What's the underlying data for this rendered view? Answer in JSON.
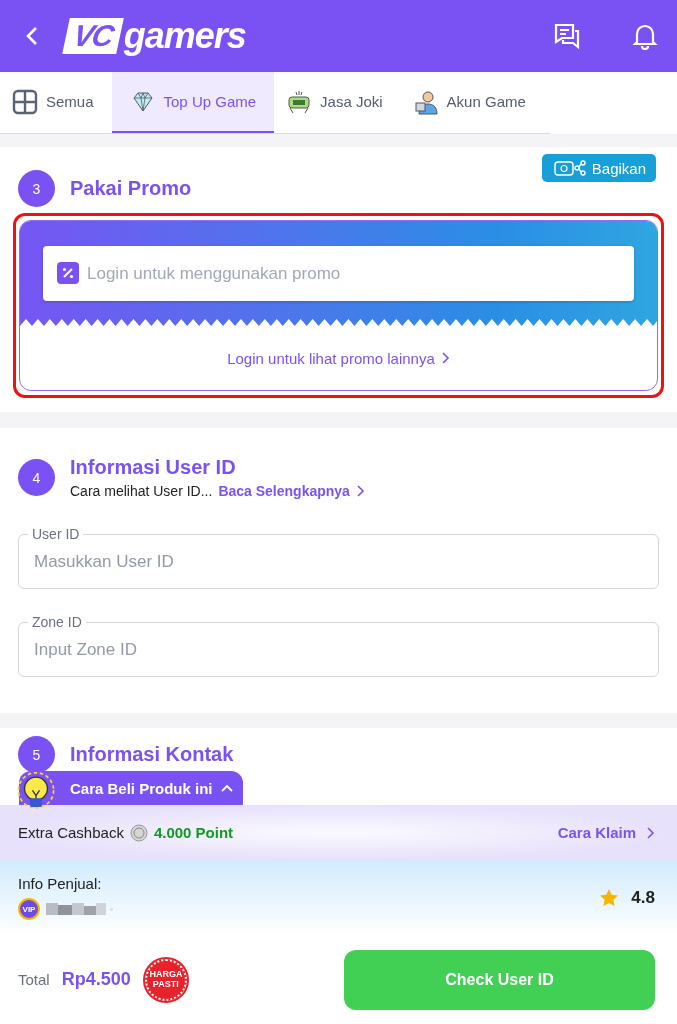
{
  "header": {
    "logo": {
      "mark": "VC",
      "word": "gamers"
    }
  },
  "tabs": [
    {
      "label": "Semua",
      "selected": false
    },
    {
      "label": "Top Up Game",
      "selected": true
    },
    {
      "label": "Jasa Joki",
      "selected": false
    },
    {
      "label": "Akun Game",
      "selected": false
    }
  ],
  "promo_section": {
    "step": "3",
    "title": "Pakai Promo",
    "share_button": "Bagikan",
    "highlighted": true,
    "promo_field": {
      "placeholder": "Login untuk menggunakan promo"
    },
    "more_link": "Login untuk lihat promo lainnya"
  },
  "user_id_section": {
    "step": "4",
    "title": "Informasi User ID",
    "hint": "Cara melihat User ID...",
    "hint_link": "Baca Selengkapnya",
    "fields": [
      {
        "label": "User ID",
        "placeholder": "Masukkan User ID"
      },
      {
        "label": "Zone ID",
        "placeholder": "Input Zone ID"
      }
    ]
  },
  "contact_section": {
    "step": "5",
    "title": "Informasi Kontak"
  },
  "how_to_buy_tab": {
    "label": "Cara Beli Produk ini"
  },
  "cashback": {
    "label": "Extra Cashback",
    "points": "4.000 Point",
    "link": "Cara Klaim"
  },
  "seller": {
    "label": "Info Penjual:",
    "vip_badge": "VIP",
    "rating": "4.8"
  },
  "footer": {
    "total_label": "Total",
    "total": "Rp4.500",
    "price_badge": "HARGA PASTI",
    "button": "Check User ID"
  }
}
